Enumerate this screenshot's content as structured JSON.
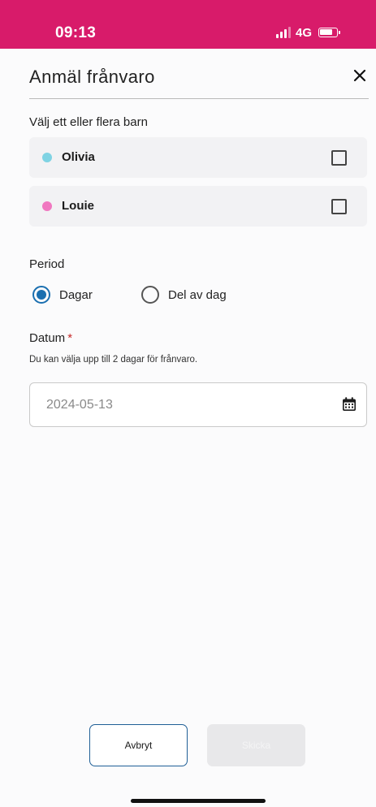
{
  "status_bar": {
    "time": "09:13",
    "network": "4G",
    "accent_color": "#d81b6a"
  },
  "header": {
    "title": "Anmäl frånvaro",
    "close_icon": "close-icon"
  },
  "children": {
    "label": "Välj ett eller flera barn",
    "items": [
      {
        "name": "Olivia",
        "dot_color": "#7fd3e3",
        "checked": false
      },
      {
        "name": "Louie",
        "dot_color": "#f078c0",
        "checked": false
      }
    ]
  },
  "period": {
    "label": "Period",
    "options": [
      {
        "label": "Dagar",
        "selected": true
      },
      {
        "label": "Del av dag",
        "selected": false
      }
    ]
  },
  "date": {
    "label": "Datum",
    "required_mark": "*",
    "help_text": "Du kan välja upp till 2 dagar för frånvaro.",
    "value": "2024-05-13",
    "icon": "calendar-icon"
  },
  "actions": {
    "cancel_label": "Avbryt",
    "send_label": "Skicka",
    "primary_color": "#1f5f96"
  }
}
